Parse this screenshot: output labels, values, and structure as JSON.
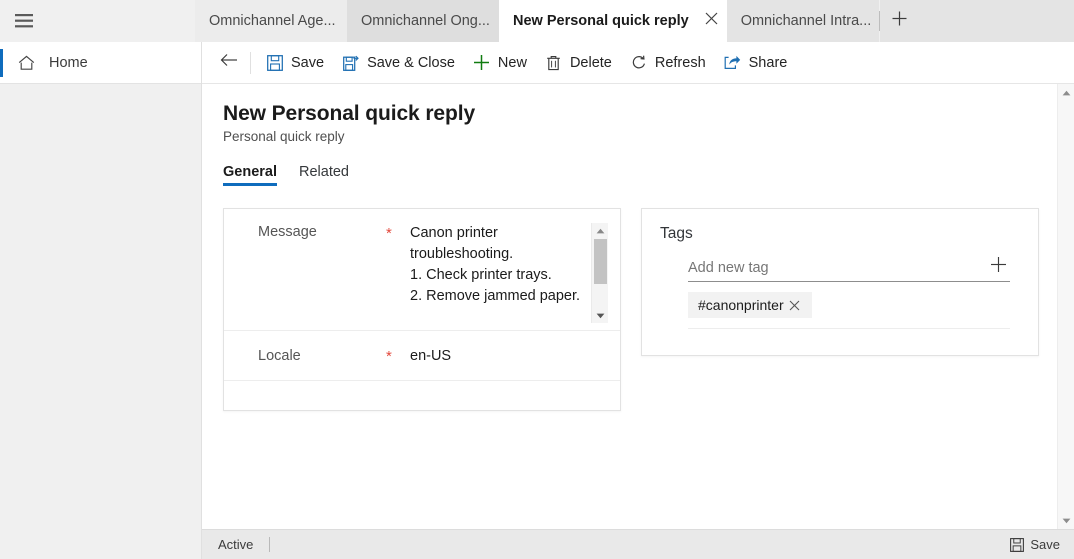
{
  "browser": {
    "menu_icon": "hamburger-icon",
    "new_tab_icon": "plus-icon",
    "tabs": [
      {
        "label": "Omnichannel Age...",
        "active": false
      },
      {
        "label": "Omnichannel Ong...",
        "active": false
      },
      {
        "label": "New Personal quick reply",
        "active": true
      },
      {
        "label": "Omnichannel Intra...",
        "active": false
      }
    ],
    "close_tab_icon": "close-icon"
  },
  "leftnav": {
    "home": {
      "label": "Home",
      "icon": "home-icon"
    }
  },
  "commandbar": {
    "back_icon": "back-arrow-icon",
    "buttons": [
      {
        "label": "Save",
        "icon": "save-icon"
      },
      {
        "label": "Save & Close",
        "icon": "save-and-close-icon"
      },
      {
        "label": "New",
        "icon": "plus-icon"
      },
      {
        "label": "Delete",
        "icon": "trash-icon"
      },
      {
        "label": "Refresh",
        "icon": "refresh-icon"
      },
      {
        "label": "Share",
        "icon": "share-icon"
      }
    ]
  },
  "form": {
    "title": "New Personal quick reply",
    "subtitle": "Personal quick reply",
    "tabs": [
      {
        "label": "General",
        "active": true
      },
      {
        "label": "Related",
        "active": false
      }
    ],
    "fields": {
      "message": {
        "label": "Message",
        "required_marker": "*",
        "value": "Canon printer troubleshooting.\n1. Check printer trays.\n2. Remove jammed paper."
      },
      "locale": {
        "label": "Locale",
        "required_marker": "*",
        "value": "en-US"
      }
    }
  },
  "tags": {
    "title": "Tags",
    "input_placeholder": "Add new tag",
    "input_value": "",
    "add_icon": "plus-icon",
    "chips": [
      {
        "label": "#canonprinter",
        "remove_icon": "close-icon"
      }
    ]
  },
  "statusbar": {
    "state": "Active",
    "save": {
      "label": "Save",
      "icon": "save-icon"
    }
  },
  "colors": {
    "accent_blue": "#0f6cbd",
    "icon_blue": "#1f6fb2",
    "required_red": "#e3493d",
    "new_green": "#107c10",
    "nav_bg": "#f0f0f0",
    "status_bg": "#e9e9e9"
  }
}
